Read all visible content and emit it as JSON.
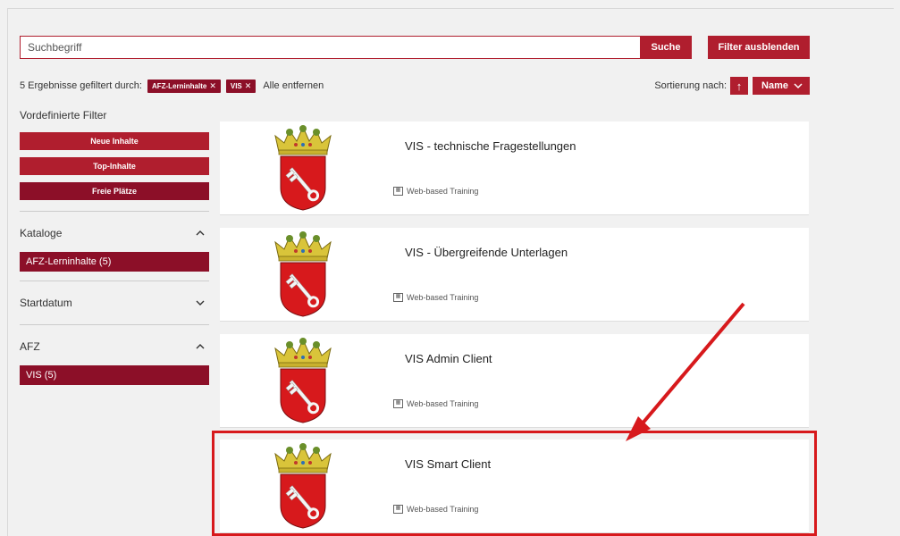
{
  "search": {
    "placeholder": "Suchbegriff",
    "button_label": "Suche"
  },
  "filter_toggle_label": "Filter ausblenden",
  "results": {
    "summary": "5 Ergebnisse gefiltert durch:",
    "chips": [
      {
        "label": "AFZ-Lerninhalte"
      },
      {
        "label": "VIS"
      }
    ],
    "remove_all_label": "Alle entfernen"
  },
  "sort": {
    "label": "Sortierung nach:",
    "direction_glyph": "↑",
    "field": "Name"
  },
  "sidebar": {
    "predefined_title": "Vordefinierte Filter",
    "predefined_buttons": [
      "Neue Inhalte",
      "Top-Inhalte",
      "Freie Plätze"
    ],
    "sections": [
      {
        "title": "Kataloge",
        "expanded": true,
        "items": [
          "AFZ-Lerninhalte (5)"
        ]
      },
      {
        "title": "Startdatum",
        "expanded": false,
        "items": []
      },
      {
        "title": "AFZ",
        "expanded": true,
        "items": [
          "VIS (5)"
        ]
      }
    ]
  },
  "cards": [
    {
      "title": "VIS - technische Fragestellungen",
      "type": "Web-based Training"
    },
    {
      "title": "VIS - Übergreifende Unterlagen",
      "type": "Web-based Training"
    },
    {
      "title": "VIS Admin Client",
      "type": "Web-based Training"
    },
    {
      "title": "VIS Smart Client",
      "type": "Web-based Training"
    }
  ],
  "colors": {
    "primary_red": "#b01e2e",
    "dark_red": "#8c0f28",
    "annotation_red": "#d7191c"
  },
  "icons": {
    "chip_remove": "close-icon",
    "sort_direction": "arrow-up-icon",
    "dropdown": "chevron-down-icon",
    "section_expanded": "chevron-up-icon",
    "section_collapsed": "chevron-down-icon",
    "card_type": "training-icon",
    "card_image": "bremen-coat-of-arms-icon"
  }
}
